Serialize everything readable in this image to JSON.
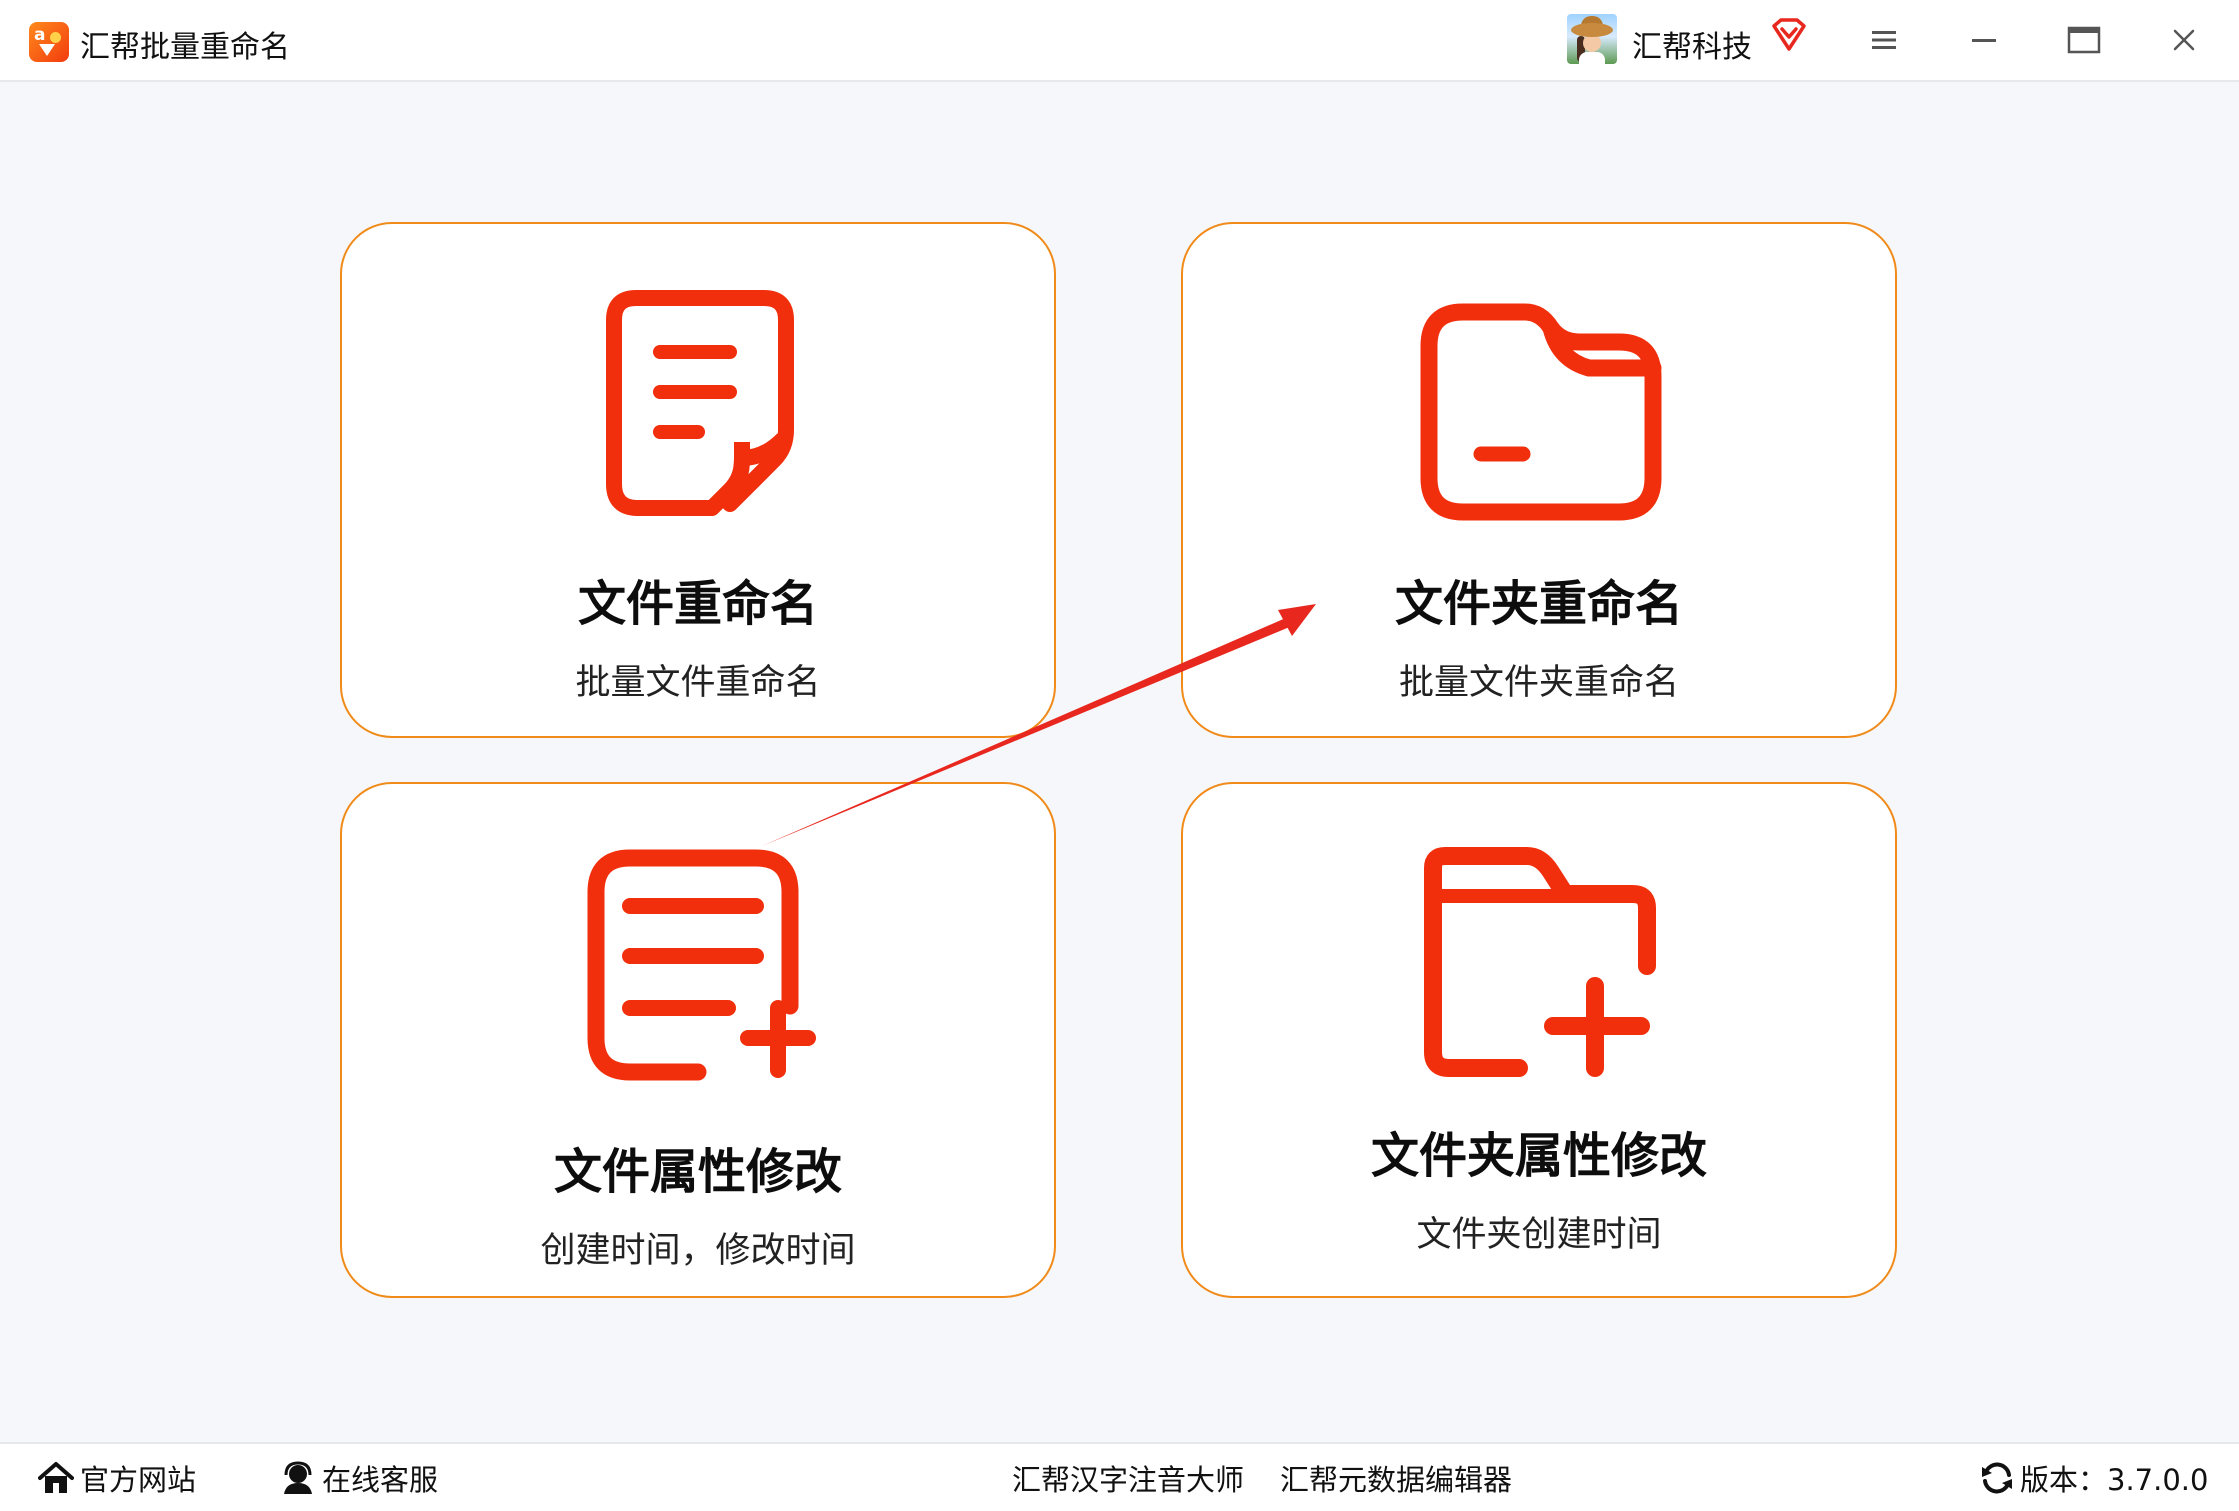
{
  "window": {
    "app_title": "汇帮批量重命名",
    "user_name": "汇帮科技",
    "icons": [
      "app-logo-icon",
      "avatar",
      "vip-icon",
      "menu-icon",
      "minimize-icon",
      "maximize-icon",
      "close-icon"
    ]
  },
  "cards": [
    {
      "title": "文件重命名",
      "subtitle": "批量文件重命名",
      "icon": "file-document-icon"
    },
    {
      "title": "文件夹重命名",
      "subtitle": "批量文件夹重命名",
      "icon": "folder-icon"
    },
    {
      "title": "文件属性修改",
      "subtitle": "创建时间，修改时间",
      "icon": "file-add-icon"
    },
    {
      "title": "文件夹属性修改",
      "subtitle": "文件夹创建时间",
      "icon": "folder-add-icon"
    }
  ],
  "footer": {
    "website": "官方网站",
    "support": "在线客服",
    "pinyin_app": "汇帮汉字注音大师",
    "metadata_app": "汇帮元数据编辑器",
    "version": "版本：3.7.0.0"
  },
  "colors": {
    "accent": "#f22f0c",
    "card_border": "#f08b1a",
    "annotation_arrow": "#e8281e",
    "background": "#f6f7fb"
  }
}
